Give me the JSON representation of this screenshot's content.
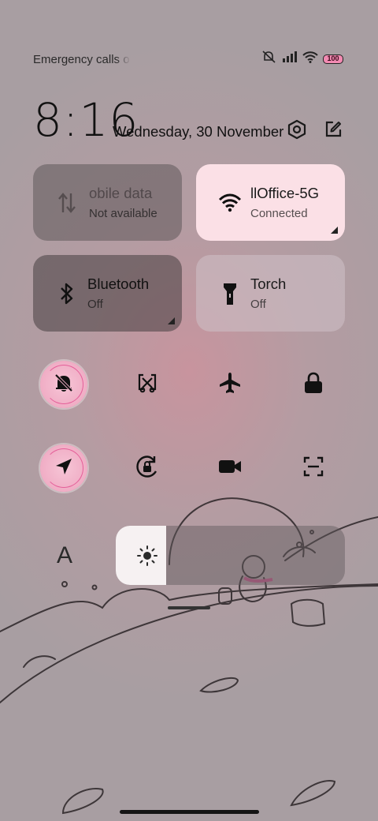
{
  "status_bar": {
    "carrier_text": "Emergency calls o",
    "battery_level": "100",
    "icons": [
      "mute-icon",
      "signal-icon",
      "wifi-icon",
      "battery-icon"
    ]
  },
  "header": {
    "time": "8:16",
    "date": "Wednesday, 30 November",
    "icons": [
      "settings-icon",
      "edit-icon"
    ]
  },
  "tiles": [
    {
      "title": "obile data",
      "status": "Not available",
      "icon": "mobile-data-icon",
      "state": "unavailable"
    },
    {
      "title": "llOffice-5G",
      "status": "Connected",
      "icon": "wifi-icon",
      "state": "on"
    },
    {
      "title": "Bluetooth",
      "status": "Off",
      "icon": "bluetooth-icon",
      "state": "off"
    },
    {
      "title": "Torch",
      "status": "Off",
      "icon": "torch-icon",
      "state": "off"
    }
  ],
  "toggles": [
    {
      "icon": "silent-mode-icon",
      "active": true
    },
    {
      "icon": "screen-cast-icon",
      "active": false
    },
    {
      "icon": "airplane-icon",
      "active": false
    },
    {
      "icon": "lock-icon",
      "active": false
    },
    {
      "icon": "location-icon",
      "active": true
    },
    {
      "icon": "rotation-lock-icon",
      "active": false
    },
    {
      "icon": "screen-record-icon",
      "active": false
    },
    {
      "icon": "screenshot-icon",
      "active": false
    }
  ],
  "brightness": {
    "level_percent": 22,
    "font_button": "A"
  },
  "colors": {
    "accent_pink": "#f0adc5",
    "tile_active": "#fbe0e6"
  }
}
